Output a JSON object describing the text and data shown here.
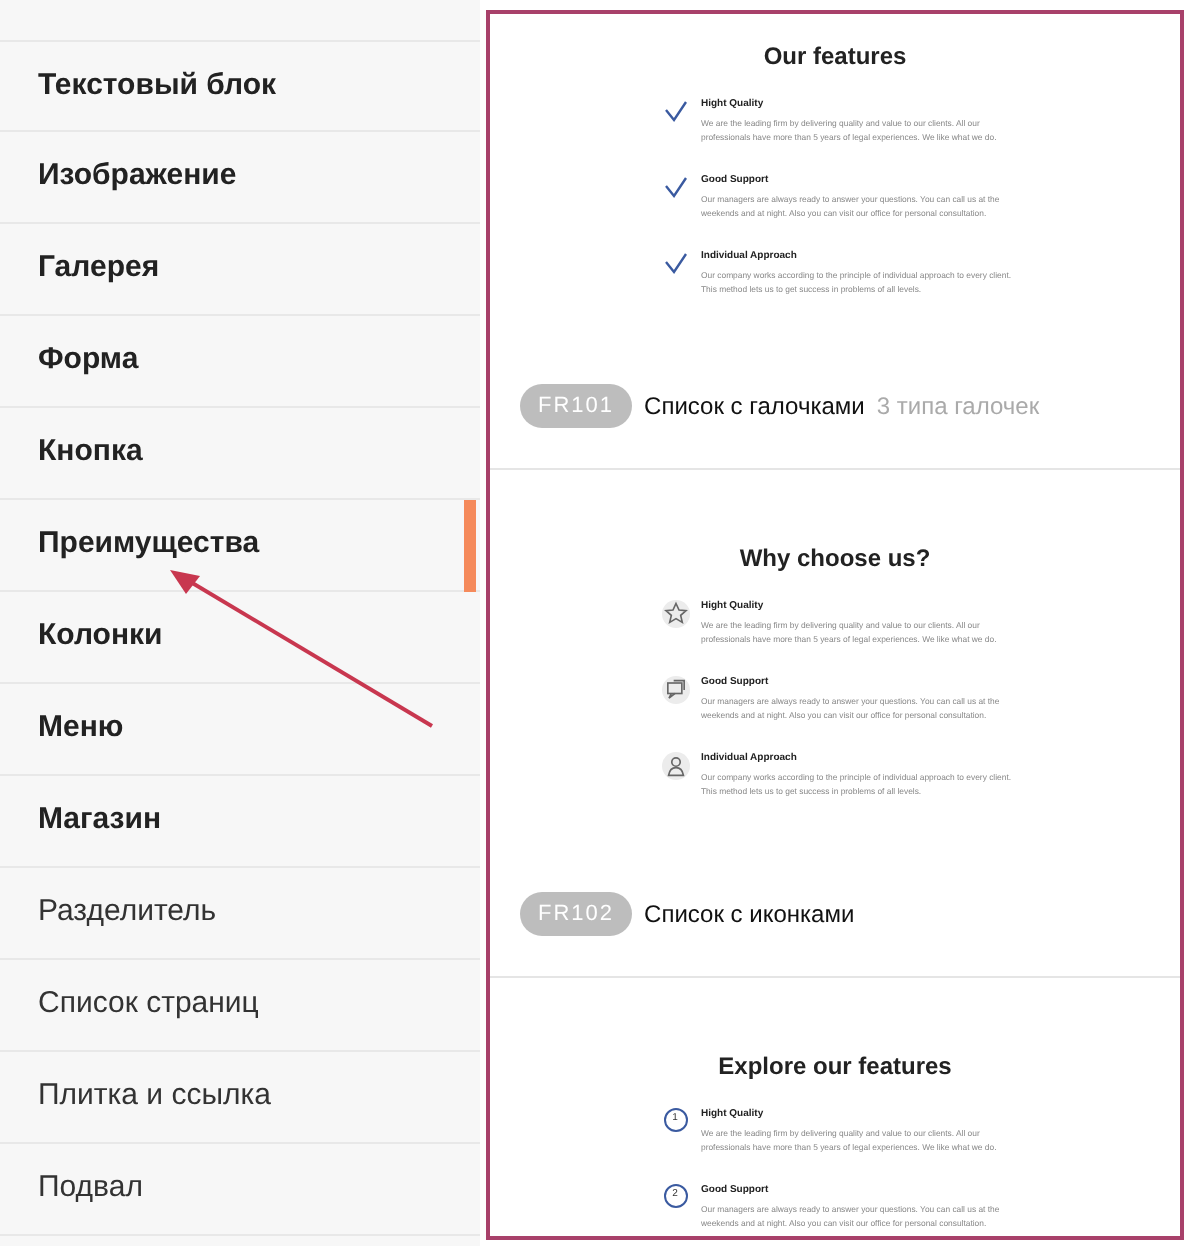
{
  "sidebar": {
    "items": [
      {
        "label": "Текстовый блок",
        "bold": true,
        "selected": false
      },
      {
        "label": "Изображение",
        "bold": true,
        "selected": false
      },
      {
        "label": "Галерея",
        "bold": true,
        "selected": false
      },
      {
        "label": "Форма",
        "bold": true,
        "selected": false
      },
      {
        "label": "Кнопка",
        "bold": true,
        "selected": false
      },
      {
        "label": "Преимущества",
        "bold": true,
        "selected": true
      },
      {
        "label": "Колонки",
        "bold": true,
        "selected": false
      },
      {
        "label": "Меню",
        "bold": true,
        "selected": false
      },
      {
        "label": "Магазин",
        "bold": true,
        "selected": false
      },
      {
        "label": "Разделитель",
        "bold": false,
        "selected": false
      },
      {
        "label": "Список страниц",
        "bold": false,
        "selected": false
      },
      {
        "label": "Плитка и ссылка",
        "bold": false,
        "selected": false
      },
      {
        "label": "Подвал",
        "bold": false,
        "selected": false
      }
    ]
  },
  "sections": [
    {
      "title": "Our features",
      "kind": "check",
      "items": [
        {
          "title": "Hight Quality",
          "text": "We are the leading firm by delivering quality and value to our clients. All our professionals have more than 5 years of legal experiences. We like what we do."
        },
        {
          "title": "Good Support",
          "text": "Our managers are always ready to answer your questions. You can call us at the weekends and at night. Also you can visit our office for personal consultation."
        },
        {
          "title": "Individual Approach",
          "text": "Our company works according to the principle of individual approach to every client. This method lets us to get success in problems of all levels."
        }
      ],
      "code": "FR101",
      "name": "Список с галочками",
      "note": "3 типа галочек"
    },
    {
      "title": "Why choose us?",
      "kind": "icon",
      "items": [
        {
          "kind": "star",
          "title": "Hight Quality",
          "text": "We are the leading firm by delivering quality and value to our clients. All our professionals have more than 5 years of legal experiences. We like what we do."
        },
        {
          "kind": "chat",
          "title": "Good Support",
          "text": "Our managers are always ready to answer your questions. You can call us at the weekends and at night. Also you can visit our office for personal consultation."
        },
        {
          "kind": "person",
          "title": "Individual Approach",
          "text": "Our company works according to the principle of individual approach to every client. This method lets us to get success in problems of all levels."
        }
      ],
      "code": "FR102",
      "name": "Список с иконками"
    },
    {
      "title": "Explore our features",
      "kind": "number",
      "items": [
        {
          "number": "1",
          "title": "Hight Quality",
          "text": "We are the leading firm by delivering quality and value to our clients. All our professionals have more than 5 years of legal experiences. We like what we do."
        },
        {
          "number": "2",
          "title": "Good Support",
          "text": "Our managers are always ready to answer your questions. You can call us at the weekends and at night. Also you can visit our office for personal consultation."
        }
      ]
    }
  ]
}
